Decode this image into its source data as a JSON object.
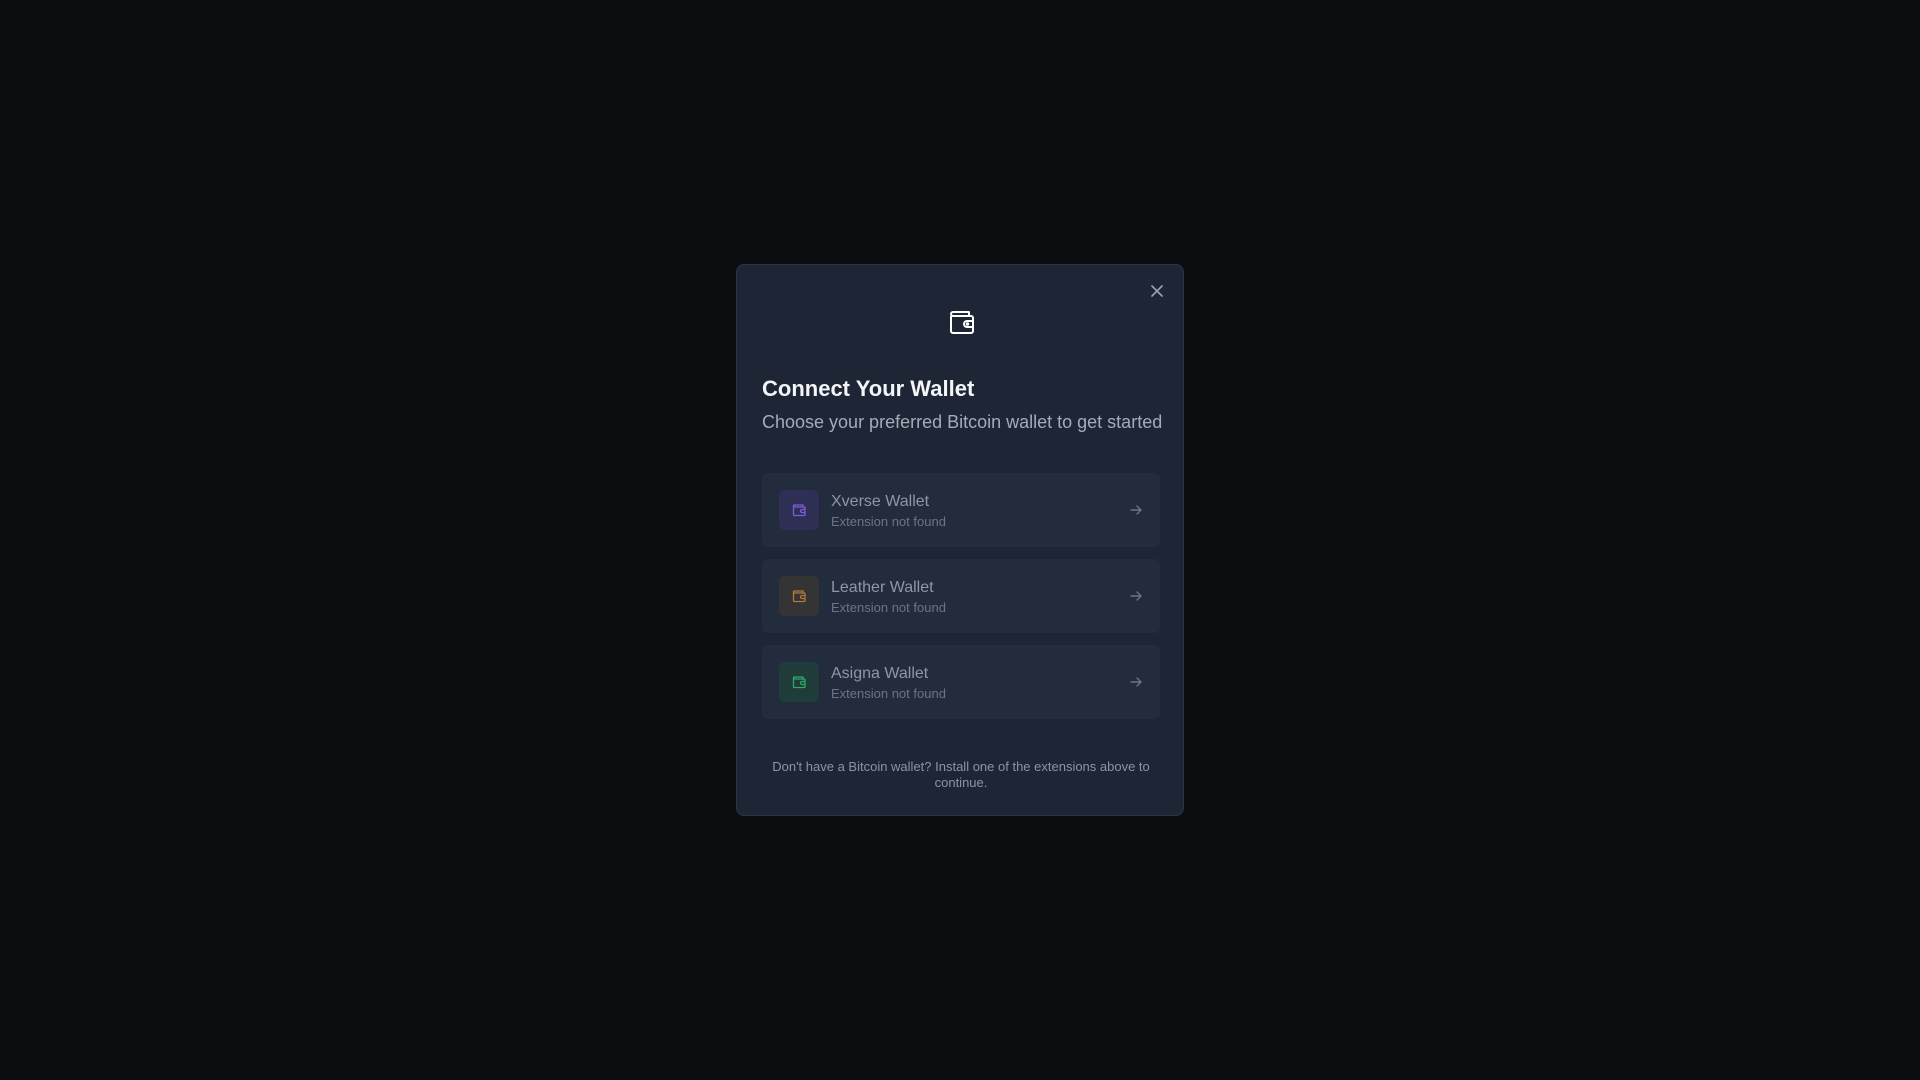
{
  "modal": {
    "title": "Connect Your Wallet",
    "subtitle": "Choose your preferred Bitcoin wallet to get started",
    "header_icon": "wallet-icon",
    "close_icon": "close-icon",
    "footer": "Don't have a Bitcoin wallet? Install one of the extensions above to continue.",
    "wallets": [
      {
        "name": "Xverse Wallet",
        "status": "Extension not found",
        "icon": "wallet-icon",
        "accent": "#7c5cd6",
        "icon_bg": "#2f2f55"
      },
      {
        "name": "Leather Wallet",
        "status": "Extension not found",
        "icon": "wallet-icon",
        "accent": "#b07a3a",
        "icon_bg": "#353434"
      },
      {
        "name": "Asigna Wallet",
        "status": "Extension not found",
        "icon": "wallet-icon",
        "accent": "#2fa86a",
        "icon_bg": "#1f3c3a"
      }
    ]
  },
  "colors": {
    "backdrop": "#0b0c0f",
    "modal_bg": "#1e2635",
    "item_bg": "#232c3c"
  }
}
